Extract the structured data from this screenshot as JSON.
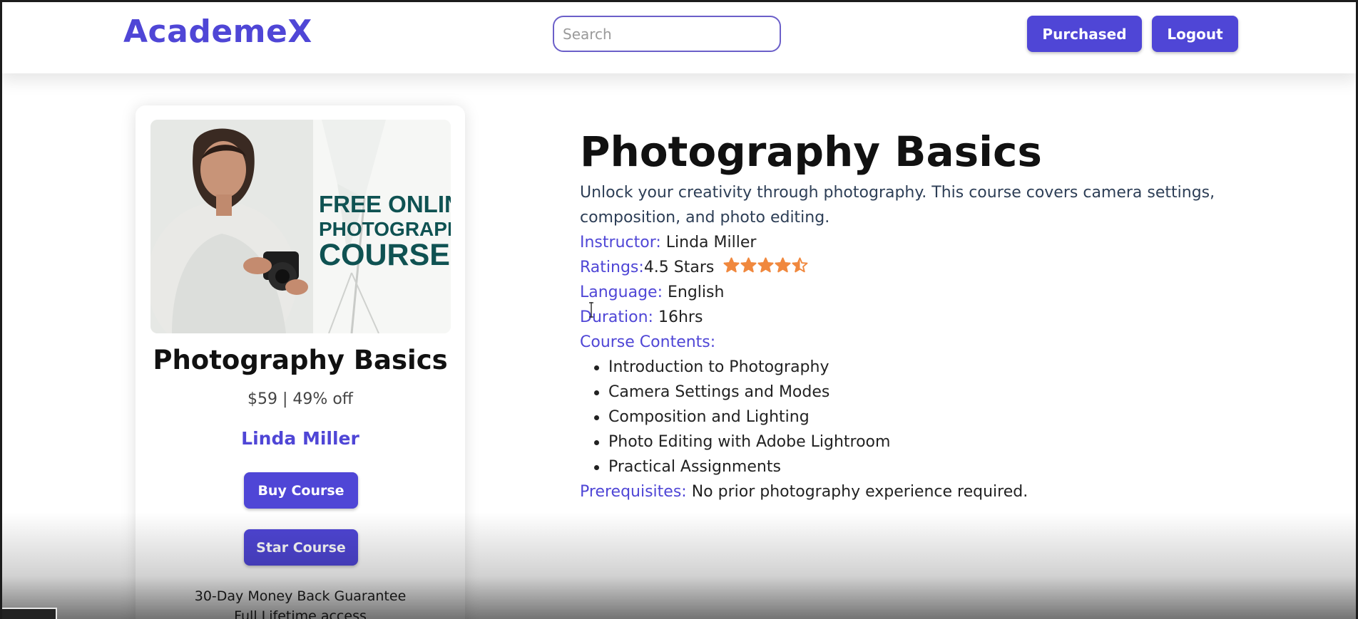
{
  "header": {
    "logo": "AcademeX",
    "search_placeholder": "Search",
    "purchased_label": "Purchased",
    "logout_label": "Logout"
  },
  "card": {
    "image_text": [
      "FREE ONLINE",
      "PHOTOGRAPHY",
      "COURSES"
    ],
    "title": "Photography Basics",
    "price": "$59 | 49% off",
    "instructor": "Linda Miller",
    "buy_label": "Buy Course",
    "star_label": "Star Course",
    "note_guarantee": "30-Day Money Back Guarantee",
    "note_access": "Full Lifetime access"
  },
  "details": {
    "title": "Photography Basics",
    "description": "Unlock your creativity through photography. This course covers camera settings, composition, and photo editing.",
    "instructor_label": "Instructor:",
    "instructor": "Linda Miller",
    "ratings_label": "Ratings:",
    "ratings_value": "4.5 Stars",
    "rating": 4.5,
    "rating_max": 5,
    "language_label": "Language:",
    "language": "English",
    "duration_label": "Duration:",
    "duration": "16hrs",
    "contents_label": "Course Contents:",
    "contents": [
      "Introduction to Photography",
      "Camera Settings and Modes",
      "Composition and Lighting",
      "Photo Editing with Adobe Lightroom",
      "Practical Assignments"
    ],
    "prereq_label": "Prerequisites:",
    "prereq": "No prior photography experience required."
  },
  "colors": {
    "accent": "#4f46d6",
    "star": "#f0883e",
    "image_text": "#0f5252"
  }
}
